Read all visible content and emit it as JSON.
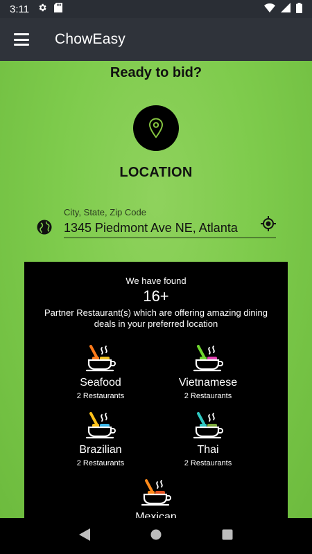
{
  "status": {
    "time": "3:11"
  },
  "appbar": {
    "title": "ChowEasy"
  },
  "main": {
    "headline": "Ready to bid?",
    "location_label": "LOCATION",
    "address_field": {
      "label": "City, State, Zip Code",
      "value": "1345 Piedmont Ave NE, Atlanta"
    }
  },
  "panel": {
    "found_text": "We have found",
    "count": "16+",
    "description": "Partner Restaurant(s) which are offering amazing dining deals in your preferred location",
    "cuisines": [
      {
        "name": "Seafood",
        "count": "2 Restaurants",
        "spoon_color": "#ff7a1a",
        "food_color": "#f0c020"
      },
      {
        "name": "Vietnamese",
        "count": "2 Restaurants",
        "spoon_color": "#6fd62f",
        "food_color": "#e23fb0"
      },
      {
        "name": "Brazilian",
        "count": "2 Restaurants",
        "spoon_color": "#ffc21a",
        "food_color": "#39b6e8"
      },
      {
        "name": "Thai",
        "count": "2 Restaurants",
        "spoon_color": "#2fc7c0",
        "food_color": "#7aa83a"
      },
      {
        "name": "Mexican",
        "count": "",
        "spoon_color": "#ff8a1a",
        "food_color": "#e05020"
      }
    ]
  }
}
